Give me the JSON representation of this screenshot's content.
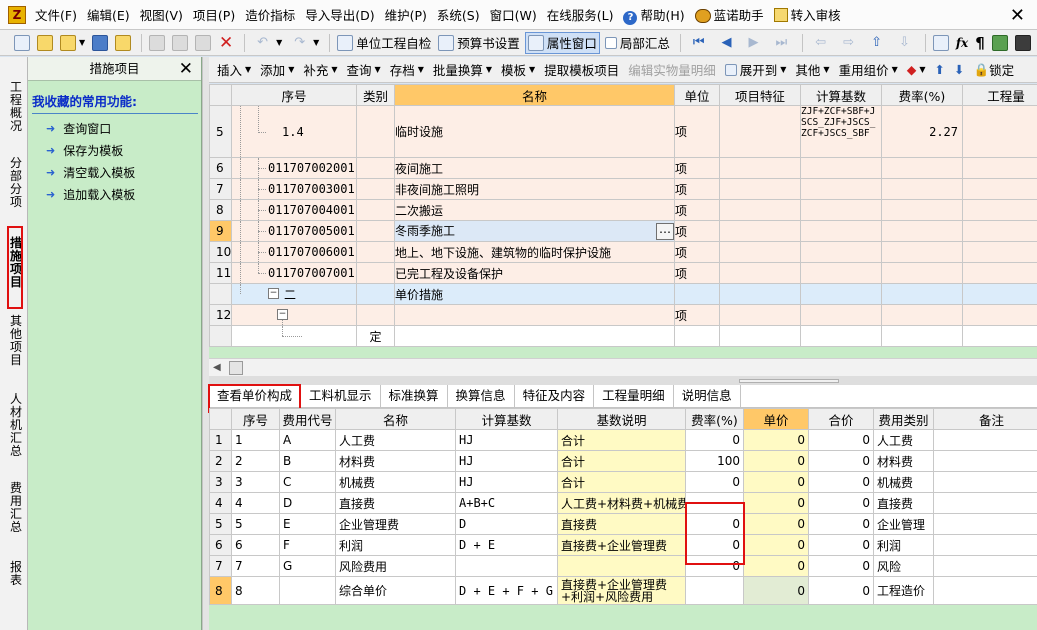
{
  "menu": {
    "app_icon_text": "Z",
    "items": [
      "文件(F)",
      "编辑(E)",
      "视图(V)",
      "项目(P)",
      "造价指标",
      "导入导出(D)",
      "维护(P)",
      "系统(S)",
      "窗口(W)",
      "在线服务(L)"
    ],
    "help": "帮助(H)",
    "helper": "蓝诺助手",
    "review": "转入审核",
    "close": "✕"
  },
  "toolbar1": {
    "check_label": "单位工程自检",
    "budget_label": "预算书设置",
    "prop_label": "属性窗口",
    "partial_label": "局部汇总",
    "fx": "fx",
    "para": "¶"
  },
  "leftnav": {
    "tabs": [
      "工程概况",
      "分部分项",
      "措施项目",
      "其他项目",
      "人材机汇总",
      "费用汇总",
      "报表"
    ]
  },
  "sidepanel": {
    "header": "措施项目",
    "close": "✕",
    "title": "我收藏的常用功能:",
    "items": [
      "查询窗口",
      "保存为模板",
      "清空载入模板",
      "追加载入模板"
    ]
  },
  "toolbar2": {
    "items": [
      "插入",
      "添加",
      "补充",
      "查询",
      "存档",
      "批量换算",
      "模板"
    ],
    "load_template": "提取模板项目",
    "edit_detail": "编辑实物量明细",
    "expand": "展开到",
    "other": "其他",
    "reuse": "重用组价",
    "lock": "锁定"
  },
  "upper_table": {
    "headers": [
      "序号",
      "类别",
      "名称",
      "单位",
      "项目特征",
      "计算基数",
      "费率(%)",
      "工程量"
    ],
    "rows": [
      {
        "rn": "5",
        "code": "1.4",
        "type": "",
        "name": "临时设施",
        "unit": "项",
        "feature": "",
        "base": "ZJF+ZCF+SBF+JSCS_ZJF+JSCS_ZCF+JSCS_SBF",
        "rate": "2.27",
        "qty": ""
      },
      {
        "rn": "6",
        "code": "011707002001",
        "type": "",
        "name": "夜间施工",
        "unit": "项",
        "feature": "",
        "base": "",
        "rate": "",
        "qty": ""
      },
      {
        "rn": "7",
        "code": "011707003001",
        "type": "",
        "name": "非夜间施工照明",
        "unit": "项",
        "feature": "",
        "base": "",
        "rate": "",
        "qty": ""
      },
      {
        "rn": "8",
        "code": "011707004001",
        "type": "",
        "name": "二次搬运",
        "unit": "项",
        "feature": "",
        "base": "",
        "rate": "",
        "qty": ""
      },
      {
        "rn": "9",
        "code": "011707005001",
        "type": "",
        "name": "冬雨季施工",
        "unit": "项",
        "feature": "",
        "base": "",
        "rate": "",
        "qty": ""
      },
      {
        "rn": "10",
        "code": "011707006001",
        "type": "",
        "name": "地上、地下设施、建筑物的临时保护设施",
        "unit": "项",
        "feature": "",
        "base": "",
        "rate": "",
        "qty": ""
      },
      {
        "rn": "11",
        "code": "011707007001",
        "type": "",
        "name": "已完工程及设备保护",
        "unit": "项",
        "feature": "",
        "base": "",
        "rate": "",
        "qty": ""
      },
      {
        "rn": "",
        "code": "二",
        "type": "",
        "name": "单价措施",
        "unit": "",
        "feature": "",
        "base": "",
        "rate": "",
        "qty": ""
      },
      {
        "rn": "12",
        "code": "",
        "type": "",
        "name": "",
        "unit": "项",
        "feature": "",
        "base": "",
        "rate": "",
        "qty": ""
      },
      {
        "rn": "",
        "code": "",
        "type": "定",
        "name": "",
        "unit": "",
        "feature": "",
        "base": "",
        "rate": "",
        "qty": ""
      }
    ],
    "dots": "…"
  },
  "lower_tabs": [
    "查看单价构成",
    "工料机显示",
    "标准换算",
    "换算信息",
    "特征及内容",
    "工程量明细",
    "说明信息"
  ],
  "lower_table": {
    "headers": [
      "序号",
      "费用代号",
      "名称",
      "计算基数",
      "基数说明",
      "费率(%)",
      "单价",
      "合价",
      "费用类别",
      "备注"
    ],
    "rows": [
      {
        "rn": "1",
        "seq": "1",
        "code": "A",
        "name": "人工费",
        "base": "HJ",
        "desc": "合计",
        "rate": "0",
        "price": "0",
        "total": "0",
        "cat": "人工费",
        "note": ""
      },
      {
        "rn": "2",
        "seq": "2",
        "code": "B",
        "name": "材料费",
        "base": "HJ",
        "desc": "合计",
        "rate": "100",
        "price": "0",
        "total": "0",
        "cat": "材料费",
        "note": ""
      },
      {
        "rn": "3",
        "seq": "3",
        "code": "C",
        "name": "机械费",
        "base": "HJ",
        "desc": "合计",
        "rate": "0",
        "price": "0",
        "total": "0",
        "cat": "机械费",
        "note": ""
      },
      {
        "rn": "4",
        "seq": "4",
        "code": "D",
        "name": "直接费",
        "base": "A+B+C",
        "desc": "人工费+材料费+机械费",
        "rate": "",
        "price": "0",
        "total": "0",
        "cat": "直接费",
        "note": ""
      },
      {
        "rn": "5",
        "seq": "5",
        "code": "E",
        "name": "企业管理费",
        "base": "D",
        "desc": "直接费",
        "rate": "0",
        "price": "0",
        "total": "0",
        "cat": "企业管理",
        "note": ""
      },
      {
        "rn": "6",
        "seq": "6",
        "code": "F",
        "name": "利润",
        "base": "D + E",
        "desc": "直接费+企业管理费",
        "rate": "0",
        "price": "0",
        "total": "0",
        "cat": "利润",
        "note": ""
      },
      {
        "rn": "7",
        "seq": "7",
        "code": "G",
        "name": "风险费用",
        "base": "",
        "desc": "",
        "rate": "0",
        "price": "0",
        "total": "0",
        "cat": "风险",
        "note": ""
      },
      {
        "rn": "8",
        "seq": "8",
        "code": "",
        "name": "综合单价",
        "base": "D + E + F + G",
        "desc": "直接费+企业管理费+利润+风险费用",
        "rate": "",
        "price": "0",
        "total": "0",
        "cat": "工程造价",
        "note": ""
      }
    ]
  },
  "colors": {
    "selected_row": "#ffc868",
    "side_panel_bg": "#c8ecc8",
    "highlight_box": "#e01010",
    "link_blue": "#0a2cc8"
  }
}
